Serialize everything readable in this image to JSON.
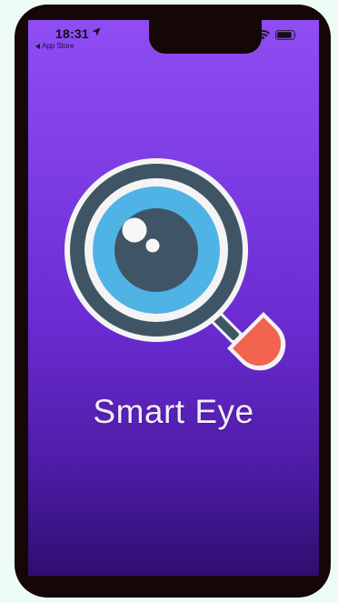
{
  "status_bar": {
    "time": "18:31",
    "back_label": "App Store"
  },
  "app": {
    "name": "Smart Eye"
  },
  "colors": {
    "gradient_top": "#8f4df3",
    "gradient_bottom": "#2f0e6e",
    "lens_ring": "#3f5566",
    "iris": "#4fb3e6",
    "handle": "#f26450"
  }
}
